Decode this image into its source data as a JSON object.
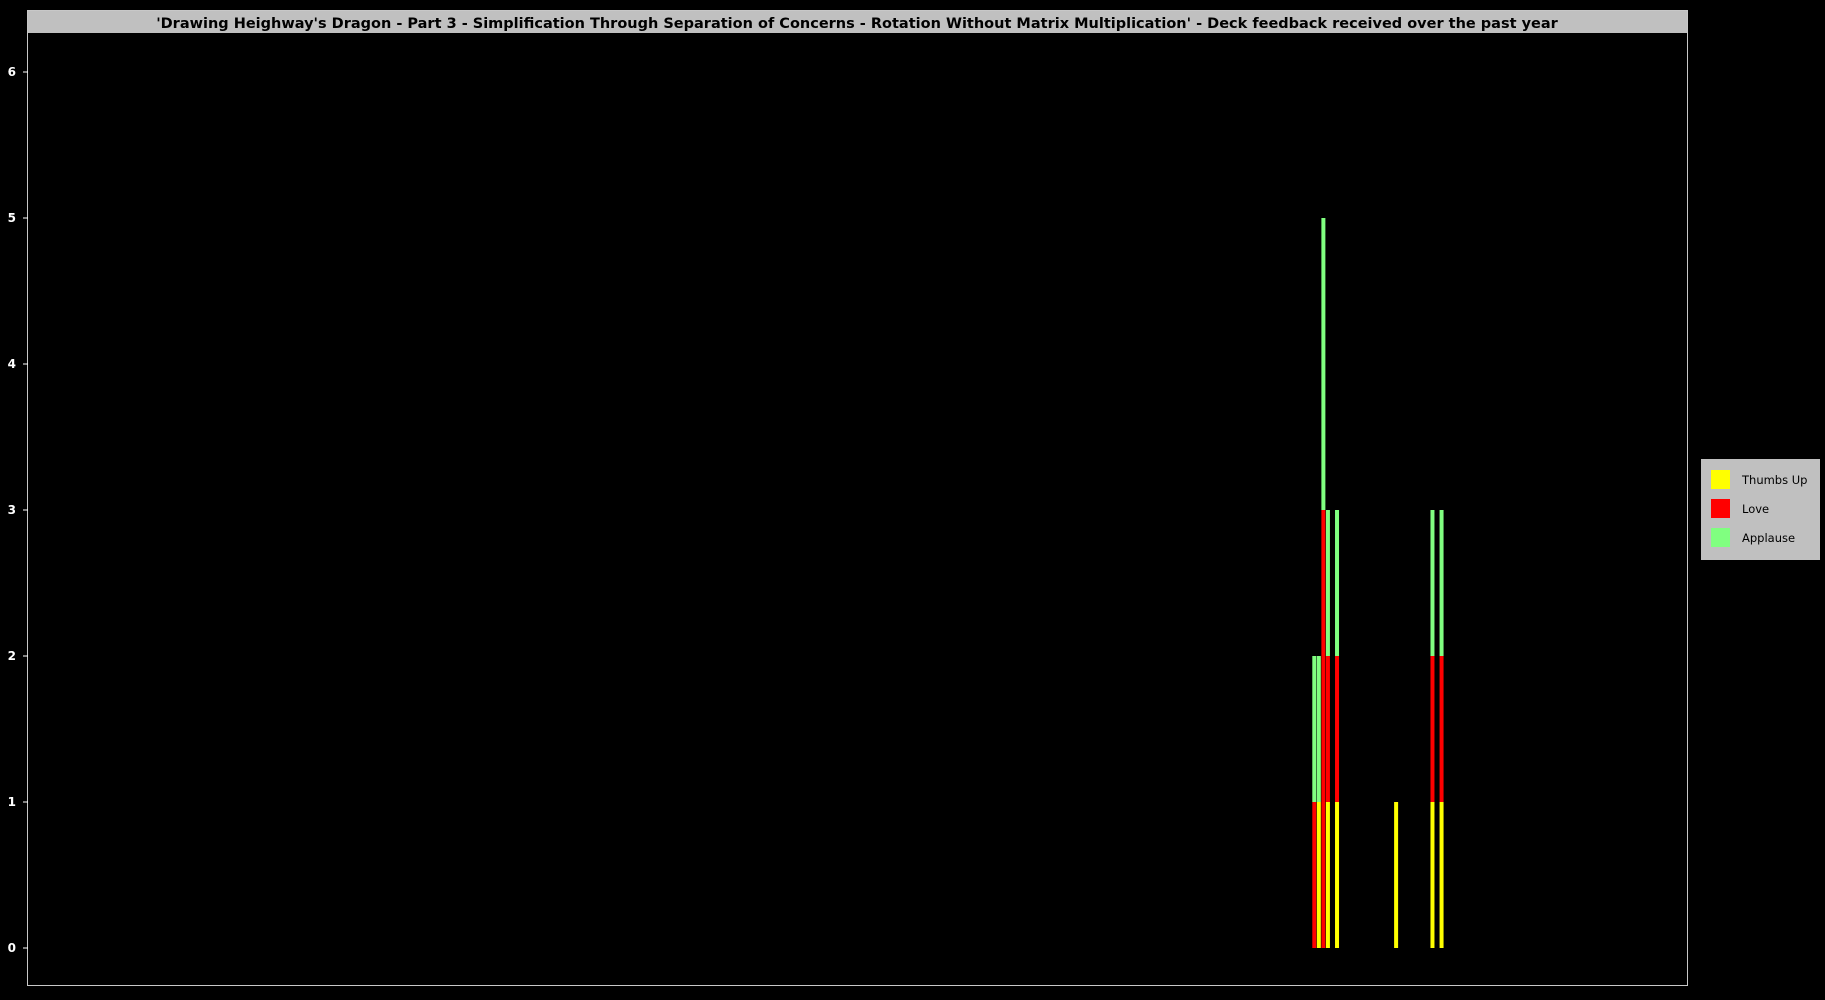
{
  "chart_data": {
    "type": "bar",
    "stacked": true,
    "title": "'Drawing Heighway's Dragon - Part 3 - Simplification Through Separation of Concerns - Rotation Without Matrix Multiplication' - Deck feedback received over the past year",
    "xlabel": "",
    "ylabel": "",
    "ylim": [
      0,
      6.2
    ],
    "yticks": [
      0,
      1,
      2,
      3,
      4,
      5,
      6
    ],
    "grid": false,
    "legend_position": "right",
    "x_range_days": [
      0,
      365
    ],
    "x": [
      283,
      284,
      285,
      286,
      288,
      301,
      309,
      311
    ],
    "series": [
      {
        "name": "Thumbs Up",
        "color": "#ffff00",
        "values": [
          0,
          1,
          0,
          1,
          1,
          1,
          1,
          1
        ]
      },
      {
        "name": "Love",
        "color": "#ff0000",
        "values": [
          1,
          0,
          3,
          1,
          1,
          0,
          1,
          1
        ]
      },
      {
        "name": "Applause",
        "color": "#80ff80",
        "values": [
          1,
          1,
          2,
          1,
          1,
          0,
          1,
          1
        ]
      }
    ],
    "colors": {
      "background": "#000000",
      "frame": "#c0c0c0",
      "text": "#ffffff"
    }
  }
}
